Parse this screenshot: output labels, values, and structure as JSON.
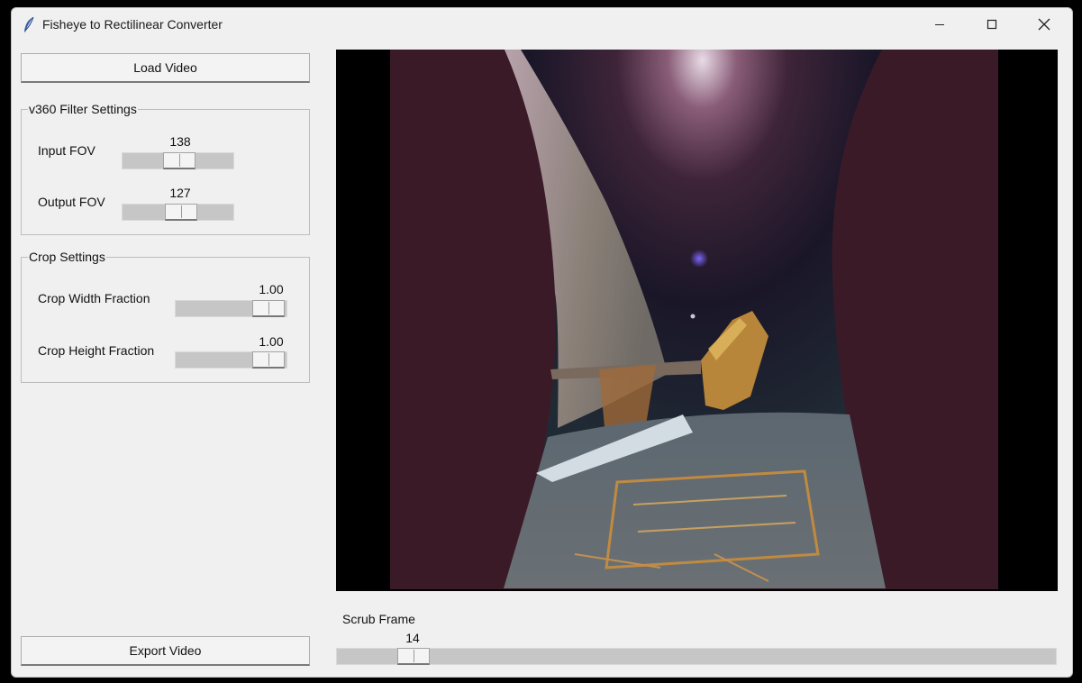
{
  "window": {
    "title": "Fisheye to Rectilinear Converter"
  },
  "buttons": {
    "load": "Load Video",
    "export": "Export Video"
  },
  "v360": {
    "label": "v360 Filter Settings",
    "input_fov": {
      "label": "Input FOV",
      "value": "138"
    },
    "output_fov": {
      "label": "Output FOV",
      "value": "127"
    }
  },
  "crop": {
    "label": "Crop Settings",
    "width": {
      "label": "Crop Width Fraction",
      "value": "1.00"
    },
    "height": {
      "label": "Crop Height Fraction",
      "value": "1.00"
    }
  },
  "scrub": {
    "label": "Scrub Frame",
    "value": "14"
  },
  "icons": {
    "app": "feather-icon",
    "minimize": "minimize-icon",
    "maximize": "maximize-icon",
    "close": "close-icon"
  },
  "colors": {
    "window_bg": "#f0f0f0",
    "trough": "#c6c6c6",
    "video_bar": "#3b1a28"
  }
}
